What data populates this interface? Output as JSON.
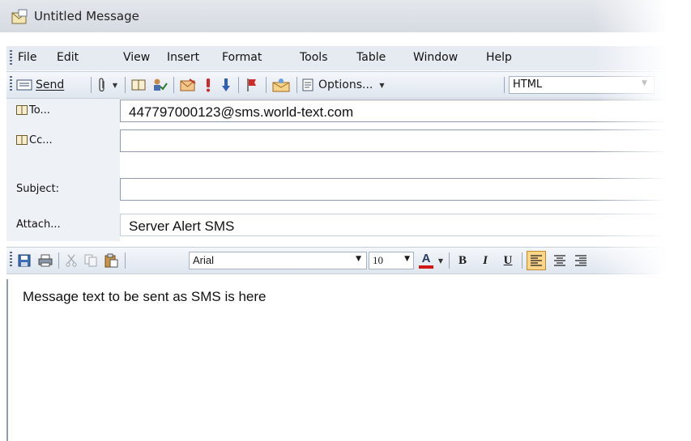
{
  "window": {
    "title": "Untitled Message"
  },
  "menubar": {
    "items": [
      {
        "label": "File"
      },
      {
        "label": "Edit"
      },
      {
        "label": "View"
      },
      {
        "label": "Insert"
      },
      {
        "label": "Format"
      },
      {
        "label": "Tools"
      },
      {
        "label": "Table"
      },
      {
        "label": "Window"
      },
      {
        "label": "Help"
      }
    ]
  },
  "toolbar": {
    "send_label": "Send",
    "options_label": "Options...",
    "message_format": "HTML"
  },
  "fields": {
    "to": {
      "label": "To...",
      "value": "447797000123@sms.world-text.com"
    },
    "cc": {
      "label": "Cc...",
      "value": ""
    },
    "subject": {
      "label": "Subject:",
      "value": ""
    },
    "attach": {
      "label": "Attach...",
      "value": "Server Alert SMS"
    }
  },
  "formatting": {
    "font": "Arial",
    "size": "10",
    "bold": "B",
    "italic": "I",
    "underline": "U",
    "font_color": "#d01818"
  },
  "body": {
    "text": "Message text to be sent as SMS is here"
  }
}
